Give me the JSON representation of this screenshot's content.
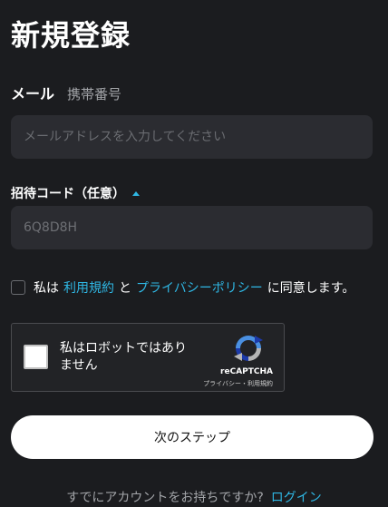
{
  "page": {
    "title": "新規登録"
  },
  "tabs": [
    {
      "label": "メール",
      "active": true
    },
    {
      "label": "携帯番号",
      "active": false
    }
  ],
  "email": {
    "placeholder": "メールアドレスを入力してください",
    "value": ""
  },
  "referral": {
    "label": "招待コード（任意）",
    "value": "6Q8D8H"
  },
  "agreement": {
    "prefix": "私は",
    "terms_link": "利用規約",
    "and": "と",
    "privacy_link": "プライバシーポリシー",
    "suffix": "に同意します。",
    "checked": false
  },
  "recaptcha": {
    "label": "私はロボットではありません",
    "brand": "reCAPTCHA",
    "links": "プライバシー・利用規約"
  },
  "next_button": {
    "label": "次のステップ"
  },
  "login": {
    "prompt": "すでにアカウントをお持ちですか?",
    "link": "ログイン"
  },
  "colors": {
    "background": "#1b1c1f",
    "input": "#2b2c31",
    "accent": "#2fb7e4",
    "button": "#ffffff"
  }
}
